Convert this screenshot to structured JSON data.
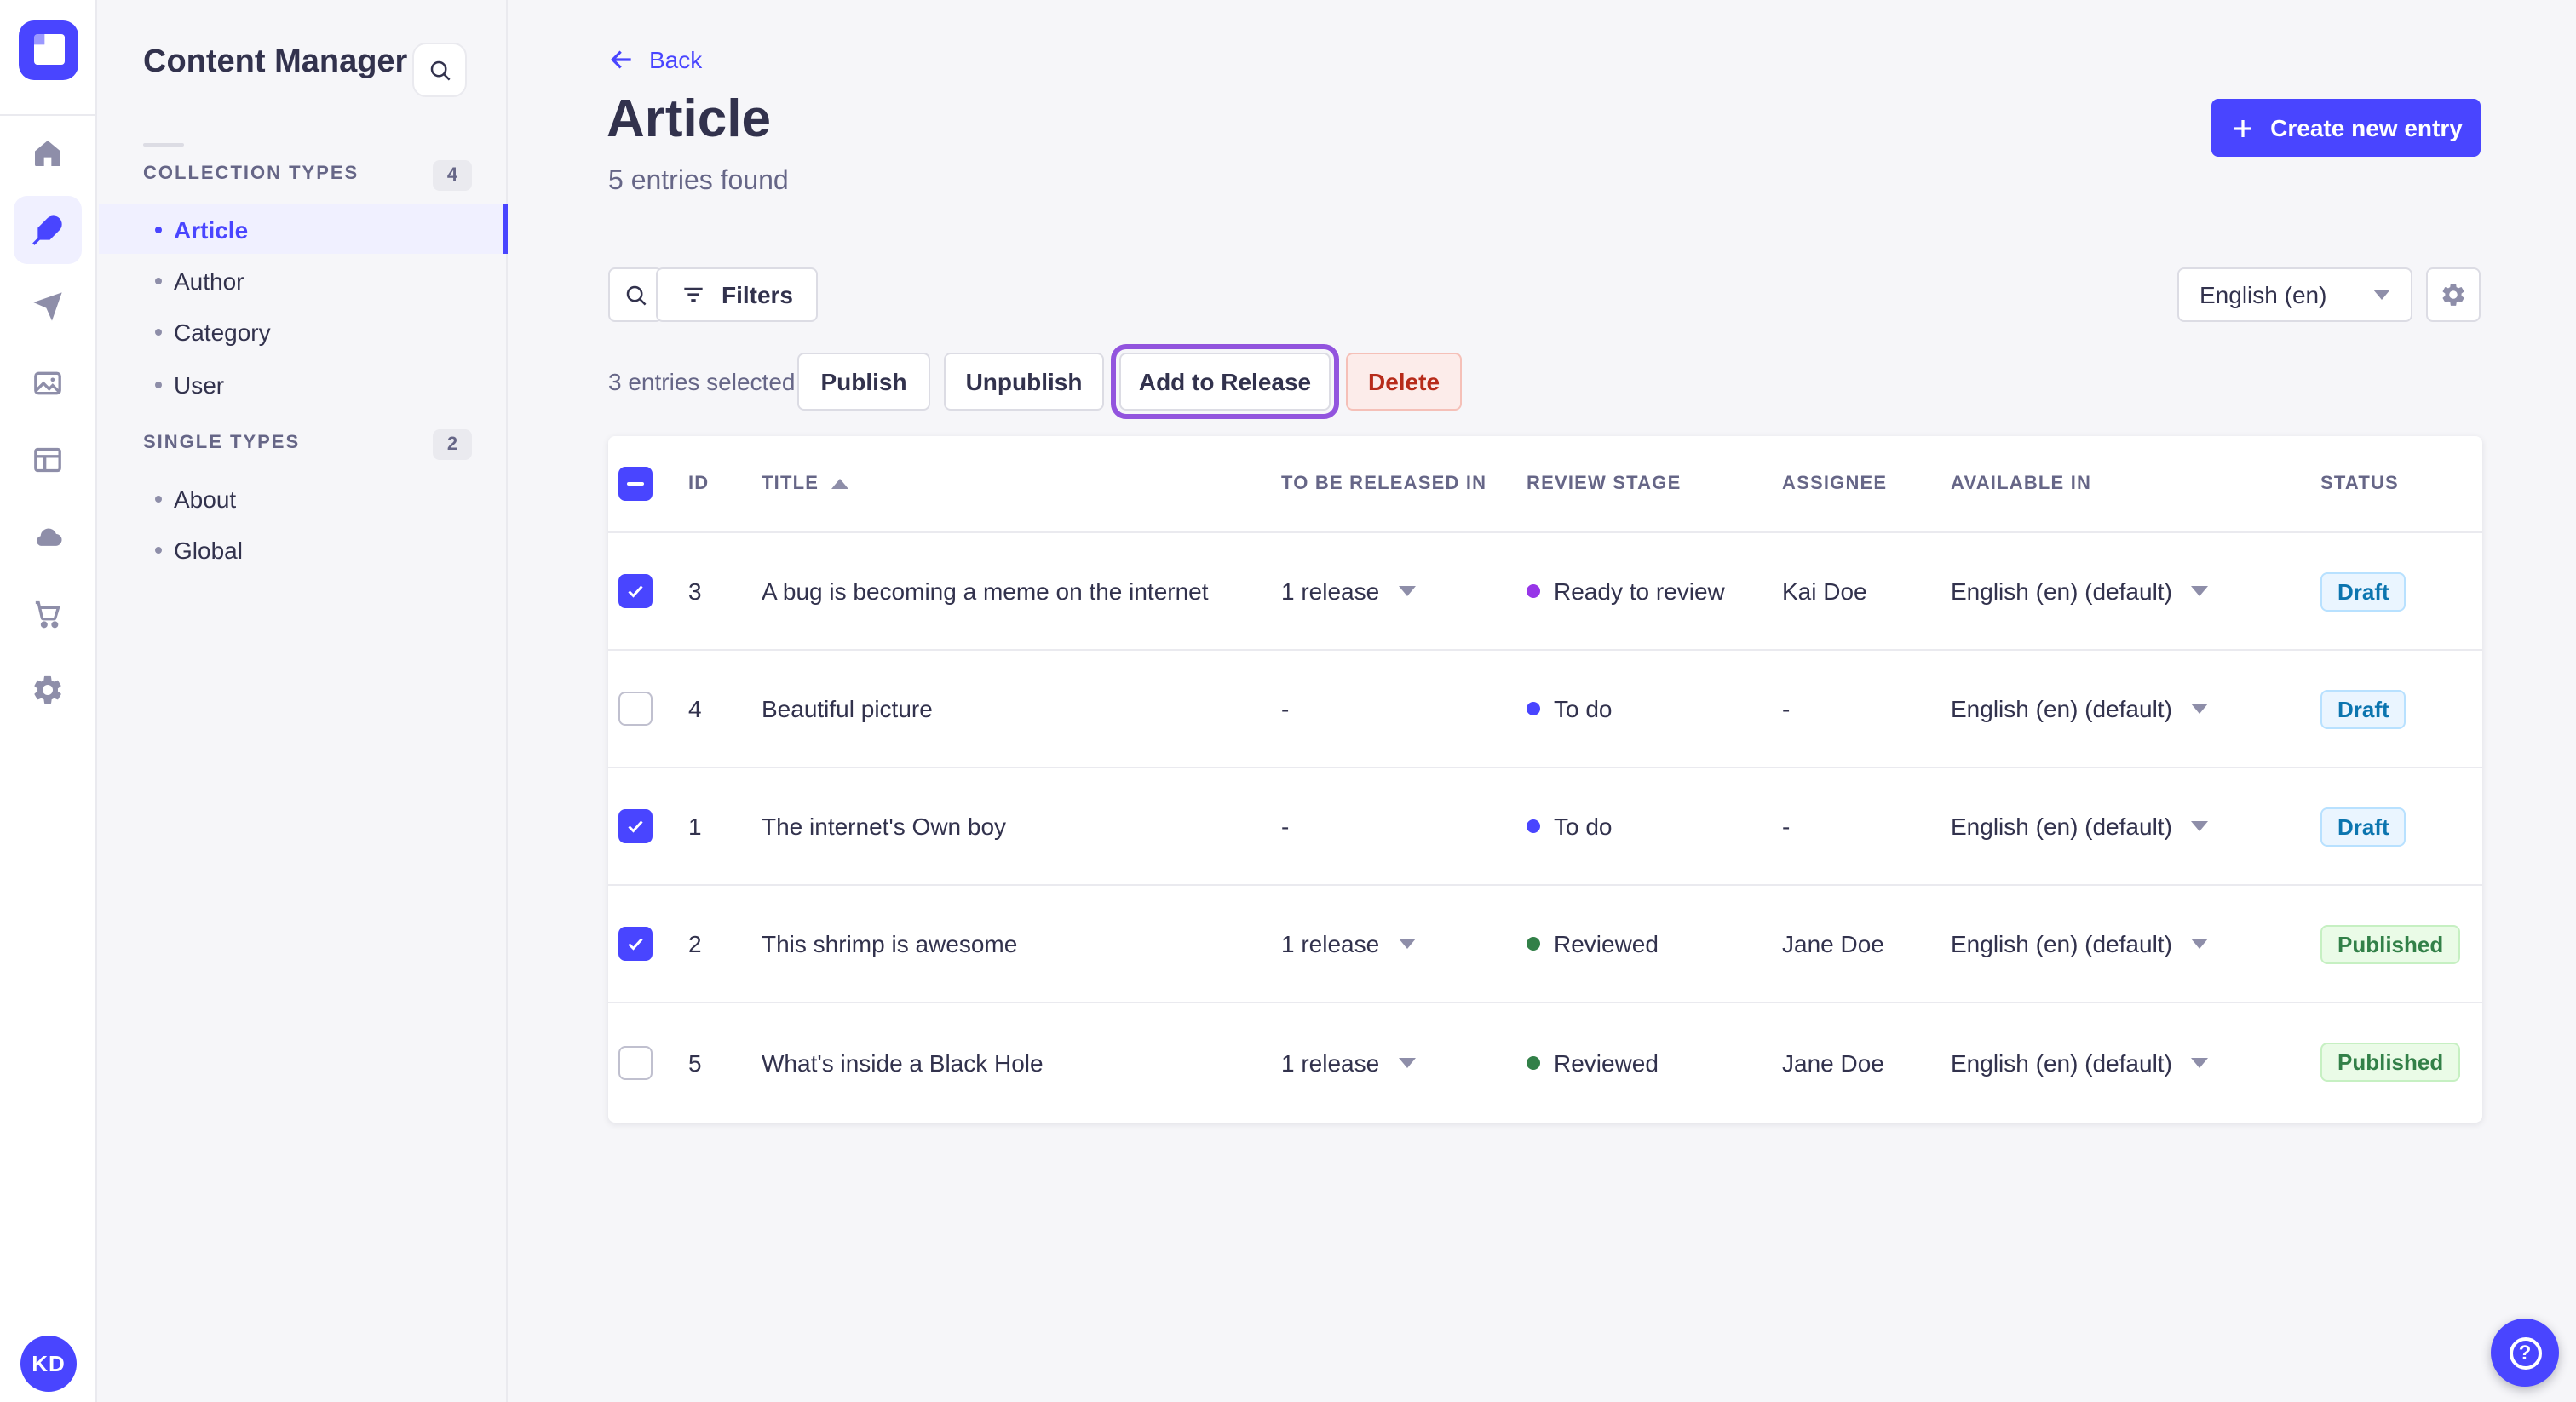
{
  "colors": {
    "primary": "#4945ff",
    "active_item_bg": "#f0f0ff",
    "release_highlight_outline": "#9254de",
    "danger_text": "#b72b1a",
    "draft_text": "#0c75af",
    "published_text": "#328048",
    "dot_todo": "#4945ff",
    "dot_ready_to_review": "#9736e8",
    "dot_reviewed": "#328048"
  },
  "rail": {
    "logo": "strapi-logo",
    "items": [
      {
        "name": "home-icon",
        "active": false
      },
      {
        "name": "content-manager-feather-icon",
        "active": true
      },
      {
        "name": "releases-send-icon",
        "active": false
      },
      {
        "name": "media-library-icon",
        "active": false
      },
      {
        "name": "content-type-builder-icon",
        "active": false
      },
      {
        "name": "cloud-deploy-icon",
        "active": false
      },
      {
        "name": "marketplace-cart-icon",
        "active": false
      },
      {
        "name": "settings-gear-icon",
        "active": false
      }
    ],
    "avatar_initials": "KD"
  },
  "sidebar": {
    "title": "Content Manager",
    "sections": [
      {
        "label": "COLLECTION TYPES",
        "count": "4",
        "items": [
          {
            "label": "Article",
            "active": true
          },
          {
            "label": "Author",
            "active": false
          },
          {
            "label": "Category",
            "active": false
          },
          {
            "label": "User",
            "active": false
          }
        ]
      },
      {
        "label": "SINGLE TYPES",
        "count": "2",
        "items": [
          {
            "label": "About",
            "active": false
          },
          {
            "label": "Global",
            "active": false
          }
        ]
      }
    ]
  },
  "header": {
    "back_label": "Back",
    "title": "Article",
    "subtitle": "5 entries found",
    "create_button_label": "Create new entry"
  },
  "toolbar": {
    "filters_label": "Filters",
    "locale_value": "English (en)"
  },
  "selection": {
    "count_text": "3 entries selected",
    "publish_label": "Publish",
    "unpublish_label": "Unpublish",
    "add_to_release_label": "Add to Release",
    "delete_label": "Delete"
  },
  "table": {
    "headers": [
      "ID",
      "TITLE",
      "TO BE RELEASED IN",
      "REVIEW STAGE",
      "ASSIGNEE",
      "AVAILABLE IN",
      "STATUS"
    ],
    "sort": {
      "column": "TITLE",
      "direction": "asc"
    },
    "rows": [
      {
        "checked": true,
        "id": "3",
        "title": "A bug is becoming a meme on the internet",
        "release": "1 release",
        "stage": "Ready to review",
        "stage_key": "ready",
        "assignee": "Kai Doe",
        "locale": "English (en) (default)",
        "status": "Draft"
      },
      {
        "checked": false,
        "id": "4",
        "title": "Beautiful picture",
        "release": "-",
        "stage": "To do",
        "stage_key": "todo",
        "assignee": "-",
        "locale": "English (en) (default)",
        "status": "Draft"
      },
      {
        "checked": true,
        "id": "1",
        "title": "The internet's Own boy",
        "release": "-",
        "stage": "To do",
        "stage_key": "todo",
        "assignee": "-",
        "locale": "English (en) (default)",
        "status": "Draft"
      },
      {
        "checked": true,
        "id": "2",
        "title": "This shrimp is awesome",
        "release": "1 release",
        "stage": "Reviewed",
        "stage_key": "reviewed",
        "assignee": "Jane Doe",
        "locale": "English (en) (default)",
        "status": "Published"
      },
      {
        "checked": false,
        "id": "5",
        "title": "What's inside a Black Hole",
        "release": "1 release",
        "stage": "Reviewed",
        "stage_key": "reviewed",
        "assignee": "Jane Doe",
        "locale": "English (en) (default)",
        "status": "Published"
      }
    ]
  },
  "fab": {
    "help_symbol": "?"
  }
}
